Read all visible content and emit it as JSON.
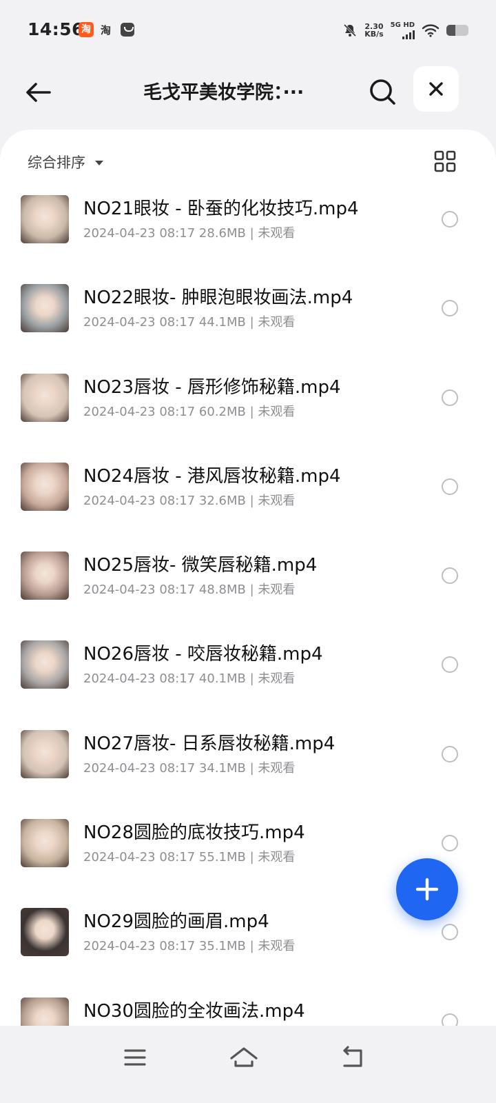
{
  "status_bar": {
    "time": "14:56",
    "app_icons": [
      "taobao-app-icon",
      "taobao-text-icon",
      "bag-app-icon"
    ],
    "taobao_glyph": "淘",
    "tao_label": "淘",
    "net_speed_value": "2.30",
    "net_speed_unit": "KB/s",
    "network": "5G HD",
    "icons": [
      "mute-bell-icon",
      "signal-icon",
      "wifi-icon",
      "battery-icon"
    ]
  },
  "header": {
    "title": "毛戈平美妆学院：···",
    "back_icon": "back-arrow-icon",
    "search_icon": "search-icon",
    "close_icon": "close-icon"
  },
  "toolbar": {
    "sort_label": "综合排序",
    "sort_icon": "caret-down-icon",
    "view_icon": "grid-view-icon"
  },
  "files": [
    {
      "name": "NO21眼妆 - 卧蚕的化妆技巧.mp4",
      "meta": "2024-04-23 08:17  28.6MB | 未观看",
      "thumb": "#c9b8a8"
    },
    {
      "name": "NO22眼妆- 肿眼泡眼妆画法.mp4",
      "meta": "2024-04-23 08:17  44.1MB | 未观看",
      "thumb": "#9aa0a4"
    },
    {
      "name": "NO23唇妆 - 唇形修饰秘籍.mp4",
      "meta": "2024-04-23 08:17  60.2MB | 未观看",
      "thumb": "#d6c4b6"
    },
    {
      "name": "NO24唇妆 - 港风唇妆秘籍.mp4",
      "meta": "2024-04-23 08:17  32.6MB | 未观看",
      "thumb": "#c7a99a"
    },
    {
      "name": "NO25唇妆-  微笑唇秘籍.mp4",
      "meta": "2024-04-23 08:17  48.8MB | 未观看",
      "thumb": "#b79c92"
    },
    {
      "name": "NO26唇妆 - 咬唇妆秘籍.mp4",
      "meta": "2024-04-23 08:17  40.1MB | 未观看",
      "thumb": "#a9a7a6"
    },
    {
      "name": "NO27唇妆- 日系唇妆秘籍.mp4",
      "meta": "2024-04-23 08:17  34.1MB | 未观看",
      "thumb": "#d3c2b5"
    },
    {
      "name": "NO28圆脸的底妆技巧.mp4",
      "meta": "2024-04-23 08:17  55.1MB | 未观看",
      "thumb": "#c8b3a0"
    },
    {
      "name": "NO29圆脸的画眉.mp4",
      "meta": "2024-04-23 08:17  35.1MB | 未观看",
      "thumb": "#3a3432"
    },
    {
      "name": "NO30圆脸的全妆画法.mp4",
      "meta": "",
      "thumb": "#b8a090"
    }
  ],
  "fab": {
    "icon": "plus-icon",
    "color": "#1f66f2"
  },
  "nav_bar": {
    "icons": [
      "menu-icon",
      "home-icon",
      "back-icon"
    ]
  }
}
